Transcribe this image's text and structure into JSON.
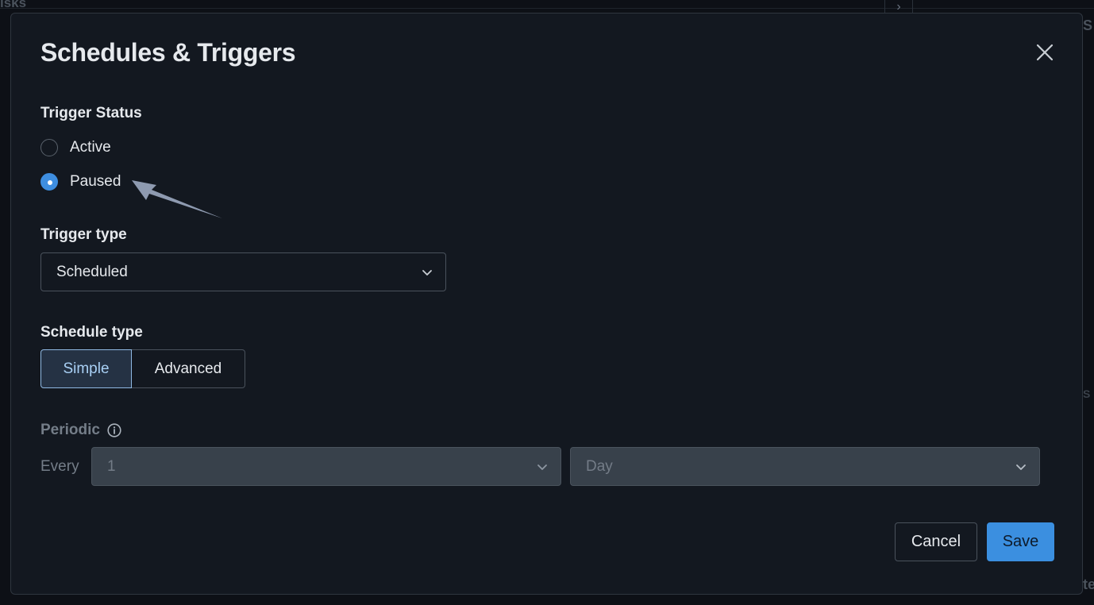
{
  "background": {
    "top_left_text": "isks",
    "right_text_1": "S",
    "right_text_2": "S",
    "right_text_3": "te"
  },
  "dialog": {
    "title": "Schedules & Triggers",
    "trigger_status": {
      "label": "Trigger Status",
      "options": [
        {
          "label": "Active",
          "checked": false
        },
        {
          "label": "Paused",
          "checked": true
        }
      ]
    },
    "trigger_type": {
      "label": "Trigger type",
      "value": "Scheduled"
    },
    "schedule_type": {
      "label": "Schedule type",
      "options": [
        {
          "label": "Simple",
          "selected": true
        },
        {
          "label": "Advanced",
          "selected": false
        }
      ]
    },
    "periodic": {
      "label": "Periodic",
      "every_label": "Every",
      "interval_value": "1",
      "unit_value": "Day"
    },
    "actions": {
      "cancel_label": "Cancel",
      "save_label": "Save"
    }
  },
  "colors": {
    "accent": "#3e8ee0",
    "modal_bg": "#131820",
    "text": "#e6e9ed",
    "muted_text": "#747d88",
    "annotation_arrow": "#8e9ab0"
  },
  "icons": {
    "close": "close-icon",
    "chevron": "chevron-down-icon",
    "info": "info-icon",
    "annotation": "annotation-arrow"
  }
}
